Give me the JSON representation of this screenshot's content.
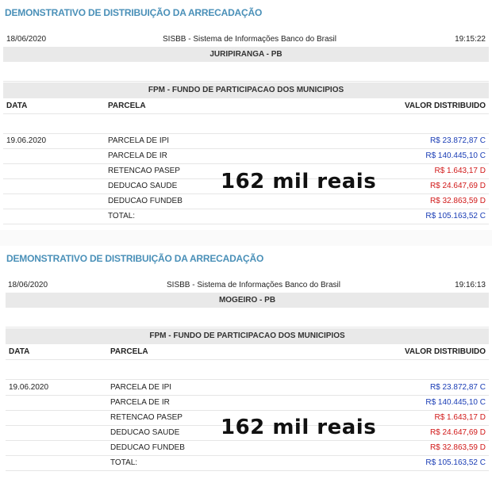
{
  "reports": [
    {
      "title": "DEMONSTRATIVO DE DISTRIBUIÇÃO DA ARRECADAÇÃO",
      "date": "18/06/2020",
      "system": "SISBB - Sistema de Informações Banco do Brasil",
      "time": "19:15:22",
      "municipality": "JURIPIRANGA - PB",
      "fund": "FPM - FUNDO DE PARTICIPACAO DOS MUNICIPIOS",
      "columns": {
        "data": "DATA",
        "parcela": "PARCELA",
        "valor": "VALOR DISTRIBUIDO"
      },
      "entry_date": "19.06.2020",
      "rows": [
        {
          "parcela": "PARCELA DE IPI",
          "valor": "R$ 23.872,87 C"
        },
        {
          "parcela": "PARCELA DE IR",
          "valor": "R$ 140.445,10 C"
        },
        {
          "parcela": "RETENCAO PASEP",
          "valor": "R$ 1.643,17 D"
        },
        {
          "parcela": "DEDUCAO SAUDE",
          "valor": "R$ 24.647,69 D"
        },
        {
          "parcela": "DEDUCAO FUNDEB",
          "valor": "R$ 32.863,59 D"
        },
        {
          "parcela": "TOTAL:",
          "valor": "R$ 105.163,52 C"
        }
      ],
      "overlay": "162 mil reais"
    },
    {
      "title": "DEMONSTRATIVO DE DISTRIBUIÇÃO DA ARRECADAÇÃO",
      "date": "18/06/2020",
      "system": "SISBB - Sistema de Informações Banco do Brasil",
      "time": "19:16:13",
      "municipality": "MOGEIRO - PB",
      "fund": "FPM - FUNDO DE PARTICIPACAO DOS MUNICIPIOS",
      "columns": {
        "data": "DATA",
        "parcela": "PARCELA",
        "valor": "VALOR DISTRIBUIDO"
      },
      "entry_date": "19.06.2020",
      "rows": [
        {
          "parcela": "PARCELA DE IPI",
          "valor": "R$ 23.872,87 C"
        },
        {
          "parcela": "PARCELA DE IR",
          "valor": "R$ 140.445,10 C"
        },
        {
          "parcela": "RETENCAO PASEP",
          "valor": "R$ 1.643,17 D"
        },
        {
          "parcela": "DEDUCAO SAUDE",
          "valor": "R$ 24.647,69 D"
        },
        {
          "parcela": "DEDUCAO FUNDEB",
          "valor": "R$ 32.863,59 D"
        },
        {
          "parcela": "TOTAL:",
          "valor": "R$ 105.163,52 C"
        }
      ],
      "overlay": "162 mil reais"
    }
  ],
  "colors": {
    "title": "#4a90b8",
    "credit": "#1a3db5",
    "debit": "#d11a1a",
    "band": "#e9e9e9"
  }
}
